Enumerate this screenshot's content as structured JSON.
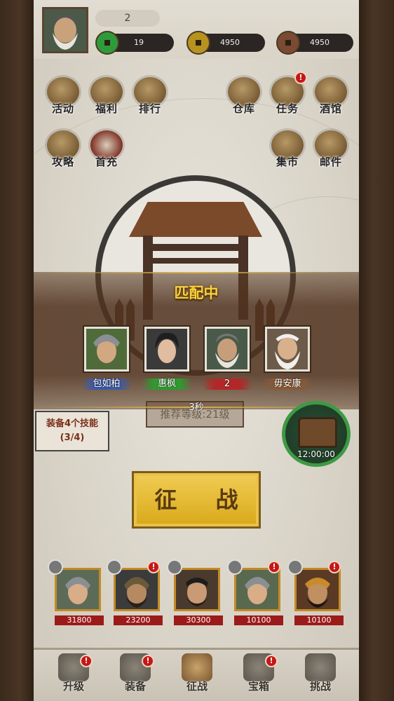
{
  "player": {
    "level": "2"
  },
  "resources": [
    {
      "name": "jade",
      "value": "19",
      "color": "#2e9b3b"
    },
    {
      "name": "gold",
      "value": "4950",
      "color": "#b8921f"
    },
    {
      "name": "copper",
      "value": "4950",
      "color": "#7a4a32"
    }
  ],
  "menu_left": [
    {
      "label": "活动",
      "icon": "event-icon"
    },
    {
      "label": "福利",
      "icon": "gift-box-icon"
    },
    {
      "label": "排行",
      "icon": "ranking-board-icon"
    }
  ],
  "menu_right": [
    {
      "label": "仓库",
      "icon": "warehouse-bag-icon"
    },
    {
      "label": "任务",
      "icon": "scroll-task-icon",
      "badge": "!"
    },
    {
      "label": "酒馆",
      "icon": "tavern-icon"
    }
  ],
  "menu_row2_left": [
    {
      "label": "攻略",
      "icon": "strategy-quill-icon"
    },
    {
      "label": "首充",
      "icon": "first-charge-icon"
    }
  ],
  "menu_row2_right": [
    {
      "label": "集市",
      "icon": "market-stall-icon"
    },
    {
      "label": "邮件",
      "icon": "mail-scroll-icon"
    }
  ],
  "match": {
    "title": "匹配中",
    "players": [
      {
        "name": "包如柏",
        "color": "#3c5aa8"
      },
      {
        "name": "惠枫",
        "color": "#2f9a2f"
      },
      {
        "name": "2",
        "color": "#b22828"
      },
      {
        "name": "毋安康",
        "color": "#8a5a35"
      }
    ],
    "timer": "3秒"
  },
  "recommend": "推荐等级:21级",
  "skills": {
    "line1": "装备4个技能",
    "line2": "(3/4)"
  },
  "chest": {
    "time": "12:00:00"
  },
  "conquer_label": "征 战",
  "heroes": [
    {
      "power": "31800",
      "badge": false
    },
    {
      "power": "23200",
      "badge": true
    },
    {
      "power": "30300",
      "badge": false
    },
    {
      "power": "10100",
      "badge": true
    },
    {
      "power": "10100",
      "badge": true
    }
  ],
  "nav": [
    {
      "label": "升级",
      "icon": "upgrade-helmet-icon",
      "badge": true
    },
    {
      "label": "装备",
      "icon": "armor-icon",
      "badge": true
    },
    {
      "label": "征战",
      "icon": "crossed-swords-icon",
      "badge": false
    },
    {
      "label": "宝箱",
      "icon": "treasure-chest-icon",
      "badge": true
    },
    {
      "label": "挑战",
      "icon": "challenge-banner-icon",
      "badge": false
    }
  ]
}
